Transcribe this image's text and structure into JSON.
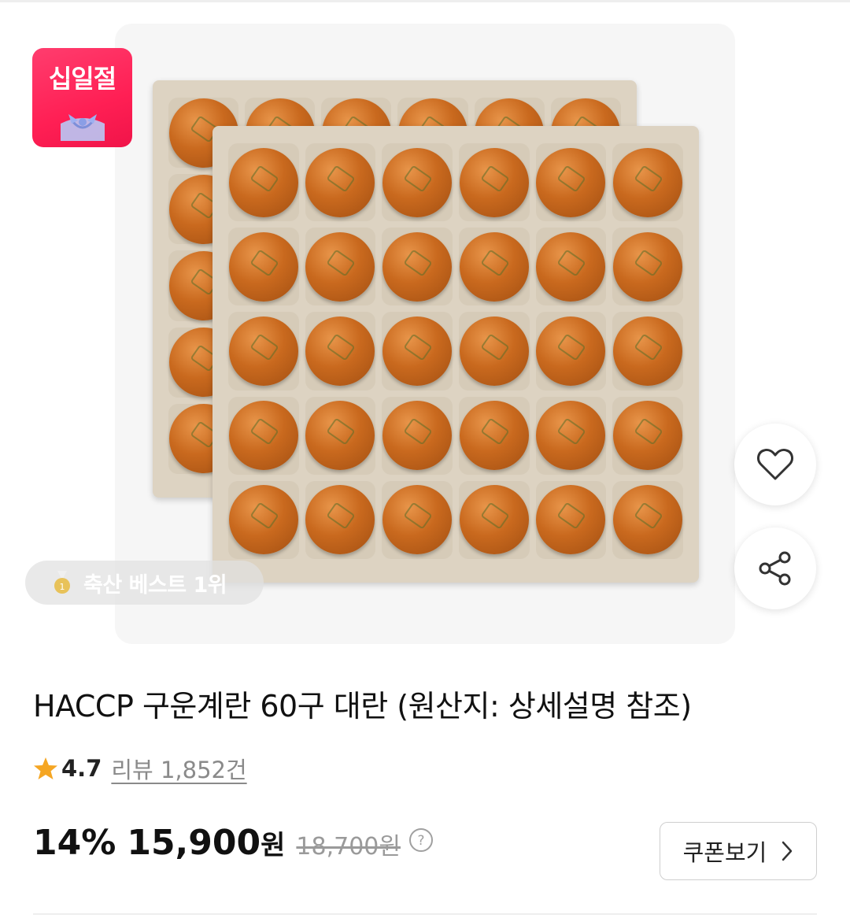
{
  "badge": {
    "text": "십일절"
  },
  "best_badge": {
    "text": "축산 베스트 1위"
  },
  "product": {
    "title": "HACCP 구운계란 60구 대란 (원산지: 상세설명 참조)",
    "rating": "4.7",
    "review_text": "리뷰 1,852건",
    "discount": "14%",
    "price": "15,900",
    "price_unit": "원",
    "original_price": "18,700원"
  },
  "coupon": {
    "label": "쿠폰보기"
  },
  "icons": {
    "heart": "heart-outline-icon",
    "share": "share-icon",
    "star": "star-icon",
    "medal": "medal-icon",
    "help": "question-circle-icon",
    "chevron": "chevron-right-icon"
  },
  "colors": {
    "badge_red": "#ff2d5f",
    "star": "#f5a623"
  }
}
